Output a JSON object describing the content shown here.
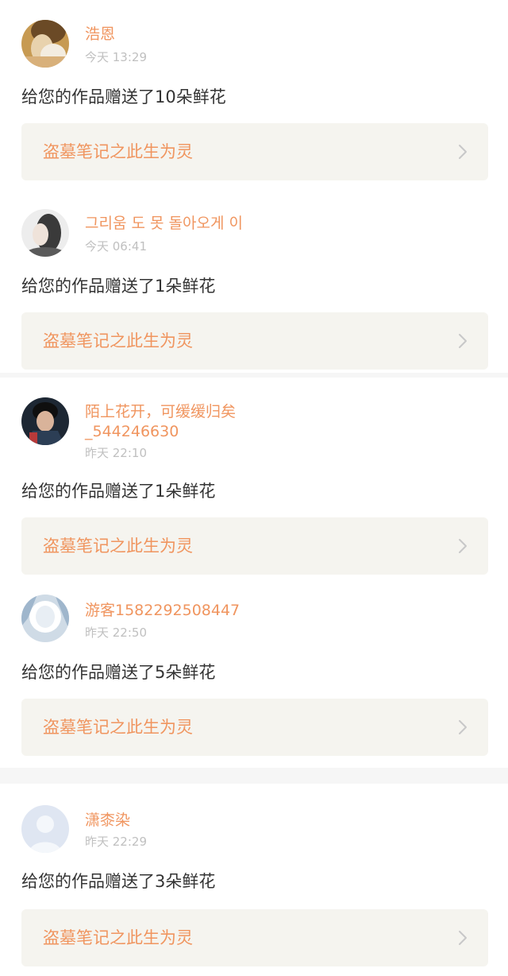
{
  "notifications": [
    {
      "username": "浩恩",
      "time": "今天 13:29",
      "message": "给您的作品赠送了10朵鲜花",
      "work_title": "盗墓笔记之此生为灵",
      "avatar_icon": "user-avatar-photo"
    },
    {
      "username": "그리움 도 못 돌아오게 이",
      "time": "今天 06:41",
      "message": "给您的作品赠送了1朵鲜花",
      "work_title": "盗墓笔记之此生为灵",
      "avatar_icon": "user-avatar-photo"
    },
    {
      "username_line1": "陌上花开，可缓缓归矣",
      "username_line2": "_544246630",
      "time": "昨天 22:10",
      "message": "给您的作品赠送了1朵鲜花",
      "work_title": "盗墓笔记之此生为灵",
      "avatar_icon": "user-avatar-photo"
    },
    {
      "username": "游客1582292508447",
      "time": "昨天 22:50",
      "message": "给您的作品赠送了5朵鲜花",
      "work_title": "盗墓笔记之此生为灵",
      "avatar_icon": "user-avatar-photo"
    },
    {
      "username": "潇桼染",
      "time": "昨天 22:29",
      "message": "给您的作品赠送了3朵鲜花",
      "work_title": "盗墓笔记之此生为灵",
      "avatar_icon": "default-avatar-icon"
    }
  ],
  "colors": {
    "username": "#f0955f",
    "timestamp": "#c0c0c0",
    "message": "#333333",
    "card_background": "#f5f4ef",
    "chevron": "#c8c8c8"
  }
}
